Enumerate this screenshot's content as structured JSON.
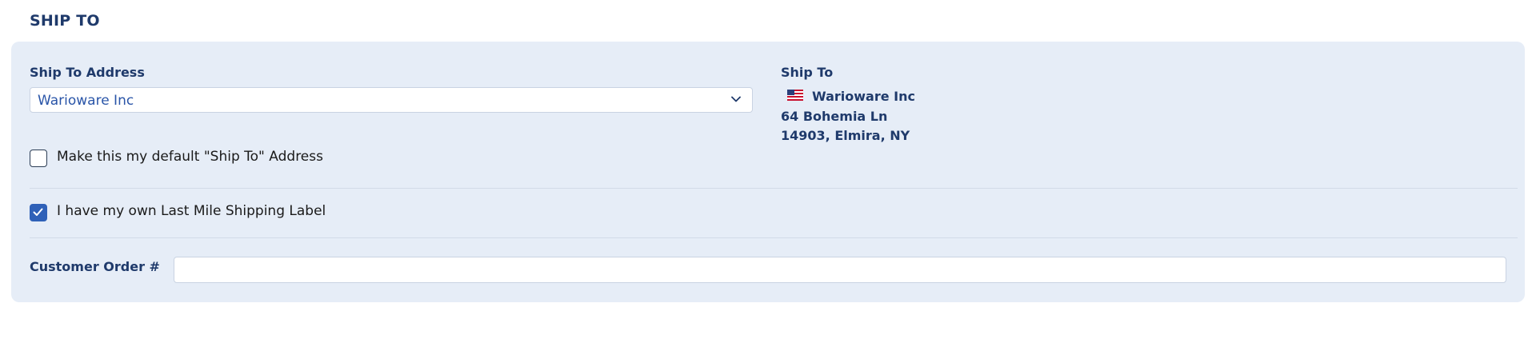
{
  "section": {
    "title": "SHIP TO"
  },
  "ship_to_address": {
    "label": "Ship To Address",
    "selected": "Warioware Inc",
    "chevron_icon": "chevron-down-icon"
  },
  "ship_to_display": {
    "label": "Ship To",
    "flag_icon": "us-flag-icon",
    "name": "Warioware Inc",
    "street": "64 Bohemia Ln",
    "city_line": "14903, Elmira, NY"
  },
  "default_address": {
    "label": "Make this my default \"Ship To\" Address",
    "checked": false
  },
  "last_mile_label": {
    "label": "I have my own Last Mile Shipping Label",
    "checked": true
  },
  "customer_order": {
    "label": "Customer Order #",
    "value": "",
    "placeholder": ""
  },
  "colors": {
    "panel_bg": "#e6edf7",
    "heading": "#1f3a6b",
    "accent": "#2f61b8",
    "select_text": "#2a55a8"
  }
}
